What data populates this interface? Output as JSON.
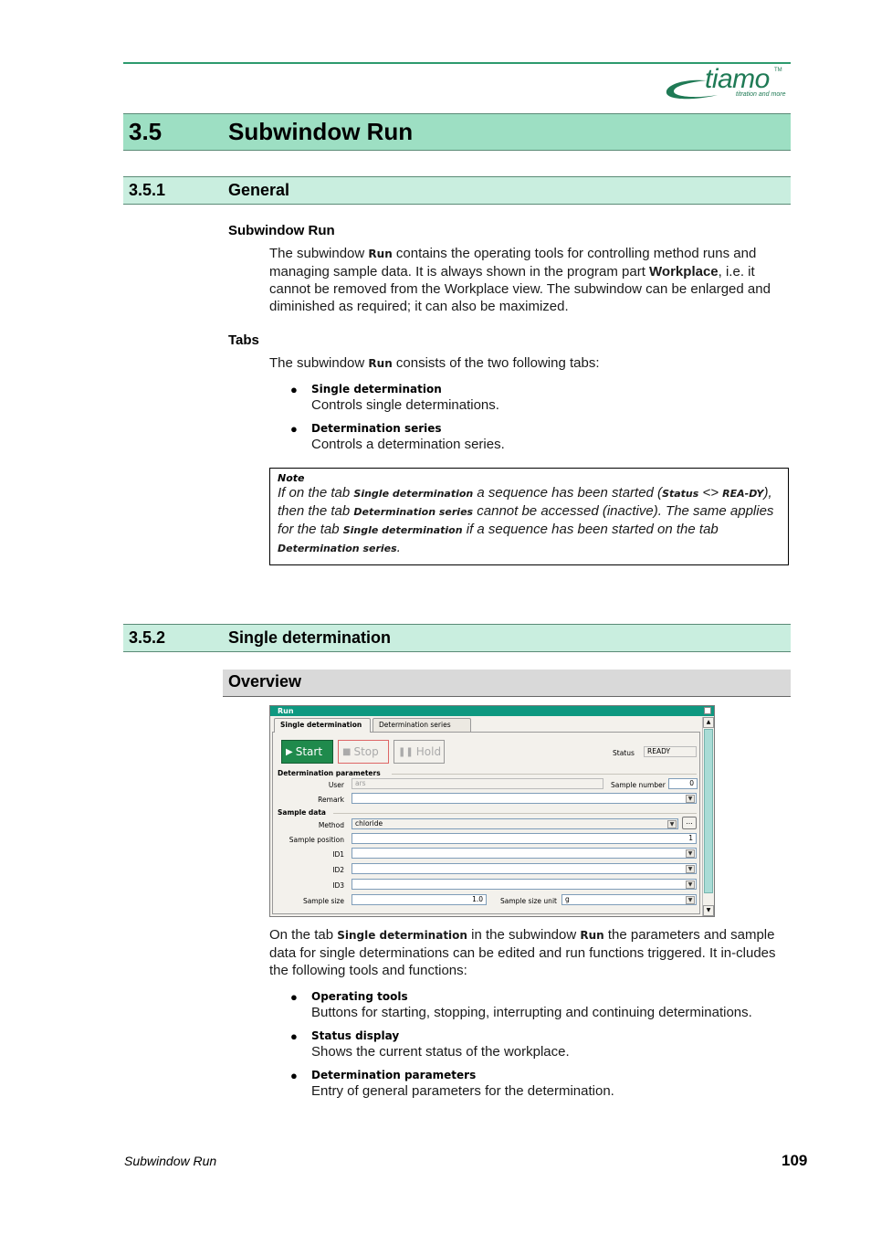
{
  "logo": {
    "word": "tiamo",
    "tm": "TM",
    "tagline": "titration and more"
  },
  "section": {
    "number": "3.5",
    "title": "Subwindow Run"
  },
  "general": {
    "number": "3.5.1",
    "title": "General",
    "subwindow_heading": "Subwindow Run",
    "para1": {
      "t1": "The subwindow ",
      "b1": "Run",
      "t2": " contains the operating tools for controlling method runs and managing sample data. It is always shown in the program part ",
      "b2": "Workplace",
      "t3": ", i.e. it cannot be removed from the Workplace view. The subwindow can be enlarged and diminished as required; it can also be maximized."
    },
    "tabs_heading": "Tabs",
    "para2": {
      "t1": "The subwindow ",
      "b1": "Run",
      "t2": " consists of the two following tabs:"
    },
    "tab_bullets": [
      {
        "title": "Single determination",
        "text": "Controls single determinations."
      },
      {
        "title": "Determination series",
        "text": "Controls a determination series."
      }
    ],
    "note": {
      "title": "Note",
      "t1": "If on the tab ",
      "b1": "Single determination",
      "t2": " a sequence has been started (",
      "b2": "Status",
      "t3": " <> ",
      "b3": "REA-DY",
      "t4": "), then the tab ",
      "b4": "Determination series",
      "t5": " cannot be accessed (inactive). The same applies for the tab ",
      "b5": "Single determination",
      "t6": " if a sequence has been started on the tab ",
      "b6": "Determination series",
      "t7": "."
    }
  },
  "single": {
    "number": "3.5.2",
    "title": "Single determination",
    "overview_heading": "Overview",
    "window": {
      "title": "Run",
      "tabs": [
        "Single determination",
        "Determination series"
      ],
      "buttons": {
        "start": "Start",
        "stop": "Stop",
        "hold": "Hold"
      },
      "status_label": "Status",
      "status_value": "READY",
      "group_params": "Determination parameters",
      "user_label": "User",
      "user_value": "ars",
      "sample_number_label": "Sample number",
      "sample_number_value": "0",
      "remark_label": "Remark",
      "remark_value": "",
      "group_sample": "Sample data",
      "method_label": "Method",
      "method_value": "chloride",
      "ellipsis": "...",
      "sample_position_label": "Sample position",
      "sample_position_value": "1",
      "id1_label": "ID1",
      "id2_label": "ID2",
      "id3_label": "ID3",
      "sample_size_label": "Sample size",
      "sample_size_value": "1.0",
      "sample_size_unit_label": "Sample size unit",
      "sample_size_unit_value": "g"
    },
    "para": {
      "t1": "On the tab ",
      "b1": "Single determination",
      "t2": " in the subwindow ",
      "b2": "Run",
      "t3": " the parameters and sample data for single determinations can be edited and run functions triggered. It in-cludes the following tools and functions:"
    },
    "bullets": [
      {
        "title": "Operating tools",
        "text": "Buttons for starting, stopping, interrupting and continuing determinations."
      },
      {
        "title": "Status display",
        "text": "Shows the current status of the workplace."
      },
      {
        "title": "Determination parameters",
        "text": "Entry of general parameters for the determination."
      }
    ]
  },
  "footer": {
    "chapter": "Subwindow Run",
    "page": "109"
  }
}
